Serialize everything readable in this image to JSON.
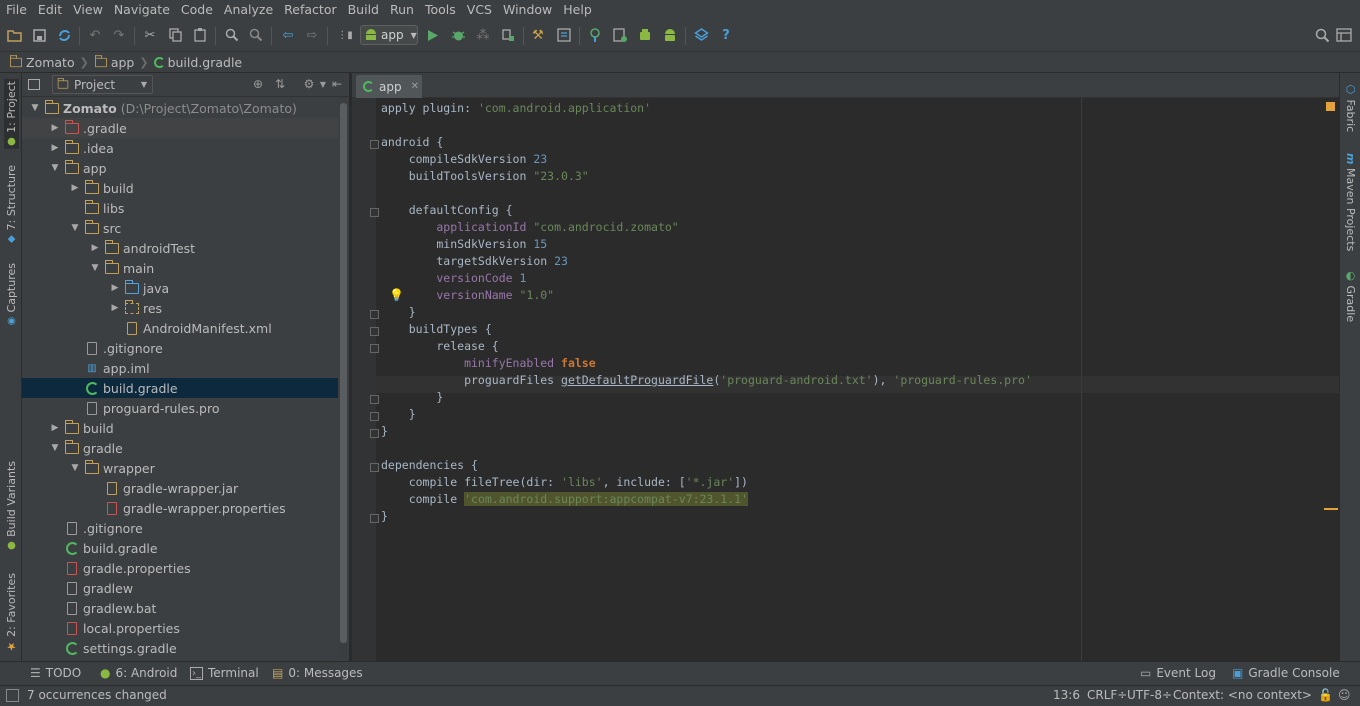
{
  "menu": [
    "File",
    "Edit",
    "View",
    "Navigate",
    "Code",
    "Analyze",
    "Refactor",
    "Build",
    "Run",
    "Tools",
    "VCS",
    "Window",
    "Help"
  ],
  "run_config": "app",
  "breadcrumb": [
    "Zomato",
    "app",
    "build.gradle"
  ],
  "left_strip": {
    "project": "1: Project",
    "structure": "7: Structure",
    "captures": "Captures",
    "build_variants": "Build Variants",
    "favorites": "2: Favorites"
  },
  "right_strip": {
    "fabric": "Fabric",
    "maven": "Maven Projects",
    "gradle": "Gradle"
  },
  "project_panel": {
    "view_selector": "Project"
  },
  "tree": [
    {
      "label": "Zomato",
      "path": "(D:\\Project\\Zomato\\Zomato)",
      "depth": 0,
      "arrow": "down",
      "icon": "module-folder"
    },
    {
      "label": ".gradle",
      "depth": 1,
      "arrow": "right",
      "icon": "excluded-folder",
      "highlight": true
    },
    {
      "label": ".idea",
      "depth": 1,
      "arrow": "right",
      "icon": "folder"
    },
    {
      "label": "app",
      "depth": 1,
      "arrow": "down",
      "icon": "module-folder"
    },
    {
      "label": "build",
      "depth": 2,
      "arrow": "right",
      "icon": "folder"
    },
    {
      "label": "libs",
      "depth": 2,
      "arrow": "none",
      "icon": "folder"
    },
    {
      "label": "src",
      "depth": 2,
      "arrow": "down",
      "icon": "folder"
    },
    {
      "label": "androidTest",
      "depth": 3,
      "arrow": "right",
      "icon": "folder"
    },
    {
      "label": "main",
      "depth": 3,
      "arrow": "down",
      "icon": "folder"
    },
    {
      "label": "java",
      "depth": 4,
      "arrow": "right",
      "icon": "source-folder"
    },
    {
      "label": "res",
      "depth": 4,
      "arrow": "right",
      "icon": "resource-folder"
    },
    {
      "label": "AndroidManifest.xml",
      "depth": 4,
      "arrow": "none",
      "icon": "manifest-file"
    },
    {
      "label": ".gitignore",
      "depth": 2,
      "arrow": "none",
      "icon": "text-file"
    },
    {
      "label": "app.iml",
      "depth": 2,
      "arrow": "none",
      "icon": "iml-file"
    },
    {
      "label": "build.gradle",
      "depth": 2,
      "arrow": "none",
      "icon": "gradle-file",
      "selected": true
    },
    {
      "label": "proguard-rules.pro",
      "depth": 2,
      "arrow": "none",
      "icon": "text-file"
    },
    {
      "label": "build",
      "depth": 1,
      "arrow": "right",
      "icon": "folder"
    },
    {
      "label": "gradle",
      "depth": 1,
      "arrow": "down",
      "icon": "folder"
    },
    {
      "label": "wrapper",
      "depth": 2,
      "arrow": "down",
      "icon": "folder"
    },
    {
      "label": "gradle-wrapper.jar",
      "depth": 3,
      "arrow": "none",
      "icon": "jar-file"
    },
    {
      "label": "gradle-wrapper.properties",
      "depth": 3,
      "arrow": "none",
      "icon": "properties-file"
    },
    {
      "label": ".gitignore",
      "depth": 1,
      "arrow": "none",
      "icon": "text-file"
    },
    {
      "label": "build.gradle",
      "depth": 1,
      "arrow": "none",
      "icon": "gradle-file"
    },
    {
      "label": "gradle.properties",
      "depth": 1,
      "arrow": "none",
      "icon": "properties-file"
    },
    {
      "label": "gradlew",
      "depth": 1,
      "arrow": "none",
      "icon": "text-file"
    },
    {
      "label": "gradlew.bat",
      "depth": 1,
      "arrow": "none",
      "icon": "text-file"
    },
    {
      "label": "local.properties",
      "depth": 1,
      "arrow": "none",
      "icon": "properties-file"
    },
    {
      "label": "settings.gradle",
      "depth": 1,
      "arrow": "none",
      "icon": "gradle-file"
    }
  ],
  "editor_tab": "app",
  "code": [
    [
      {
        "t": "apply plugin: ",
        "c": "plain"
      },
      {
        "t": "'com.android.application'",
        "c": "str"
      }
    ],
    [],
    [
      {
        "t": "android {",
        "c": "plain"
      }
    ],
    [
      {
        "t": "    compileSdkVersion ",
        "c": "plain"
      },
      {
        "t": "23",
        "c": "num"
      }
    ],
    [
      {
        "t": "    buildToolsVersion ",
        "c": "plain"
      },
      {
        "t": "\"23.0.3\"",
        "c": "str"
      }
    ],
    [],
    [
      {
        "t": "    defaultConfig {",
        "c": "plain"
      }
    ],
    [
      {
        "t": "        applicationId ",
        "c": "purple"
      },
      {
        "t": "\"com.androcid.zomato\"",
        "c": "str"
      }
    ],
    [
      {
        "t": "        minSdkVersion ",
        "c": "plain"
      },
      {
        "t": "15",
        "c": "num"
      }
    ],
    [
      {
        "t": "        targetSdkVersion ",
        "c": "plain"
      },
      {
        "t": "23",
        "c": "num"
      }
    ],
    [
      {
        "t": "        versionCode ",
        "c": "purple"
      },
      {
        "t": "1",
        "c": "num"
      }
    ],
    [
      {
        "t": "        versionName ",
        "c": "purple"
      },
      {
        "t": "\"1.0\"",
        "c": "str"
      }
    ],
    [
      {
        "t": "    }",
        "c": "plain"
      }
    ],
    [
      {
        "t": "    buildTypes {",
        "c": "plain"
      }
    ],
    [
      {
        "t": "        release {",
        "c": "plain"
      }
    ],
    [
      {
        "t": "            minifyEnabled ",
        "c": "purple"
      },
      {
        "t": "false",
        "c": "kw"
      }
    ],
    [
      {
        "t": "            proguardFiles ",
        "c": "plain"
      },
      {
        "t": "getDefaultProguardFile",
        "c": "under"
      },
      {
        "t": "(",
        "c": "plain"
      },
      {
        "t": "'proguard-android.txt'",
        "c": "str"
      },
      {
        "t": "), ",
        "c": "plain"
      },
      {
        "t": "'proguard-rules.pro'",
        "c": "str"
      }
    ],
    [
      {
        "t": "        }",
        "c": "plain"
      }
    ],
    [
      {
        "t": "    }",
        "c": "plain"
      }
    ],
    [
      {
        "t": "}",
        "c": "plain"
      }
    ],
    [],
    [
      {
        "t": "dependencies {",
        "c": "plain"
      }
    ],
    [
      {
        "t": "    compile fileTree(dir: ",
        "c": "plain"
      },
      {
        "t": "'libs'",
        "c": "str"
      },
      {
        "t": ", include: [",
        "c": "plain"
      },
      {
        "t": "'*.jar'",
        "c": "str"
      },
      {
        "t": "])",
        "c": "plain"
      }
    ],
    [
      {
        "t": "    compile ",
        "c": "plain"
      },
      {
        "t": "'com.android.support:appcompat-v7:23.1.1'",
        "c": "hlstr"
      }
    ],
    [
      {
        "t": "}",
        "c": "plain"
      }
    ]
  ],
  "bottom_tabs": {
    "todo": "TODO",
    "android": "6: Android",
    "terminal": "Terminal",
    "messages": "0: Messages",
    "event_log": "Event Log",
    "gradle_console": "Gradle Console"
  },
  "status": {
    "message": "7 occurrences changed",
    "position": "13:6",
    "line_sep": "CRLF÷",
    "encoding": "UTF-8÷",
    "context": "Context: <no context>"
  }
}
